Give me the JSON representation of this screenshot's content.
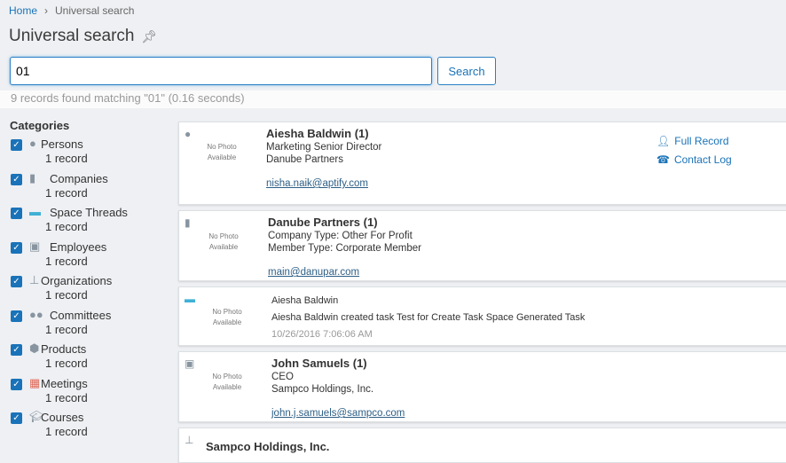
{
  "breadcrumb": {
    "home": "Home",
    "current": "Universal search"
  },
  "page_title": "Universal search",
  "search": {
    "value": "01",
    "button": "Search"
  },
  "status": "9 records found matching \"01\" (0.16 seconds)",
  "categories": {
    "title": "Categories",
    "items": [
      {
        "label": "Persons",
        "count": "1 record",
        "icon": "person-icon"
      },
      {
        "label": "Companies",
        "count": "1 record",
        "icon": "building-icon"
      },
      {
        "label": "Space Threads",
        "count": "1 record",
        "icon": "chat-icon"
      },
      {
        "label": "Employees",
        "count": "1 record",
        "icon": "monitor-icon"
      },
      {
        "label": "Organizations",
        "count": "1 record",
        "icon": "sitemap-icon"
      },
      {
        "label": "Committees",
        "count": "1 record",
        "icon": "group-icon"
      },
      {
        "label": "Products",
        "count": "1 record",
        "icon": "box-icon"
      },
      {
        "label": "Meetings",
        "count": "1 record",
        "icon": "calendar-icon"
      },
      {
        "label": "Courses",
        "count": "1 record",
        "icon": "graduation-cap-icon"
      }
    ]
  },
  "no_photo": "No Photo Available",
  "results": [
    {
      "title": "Aiesha Baldwin (1)",
      "lines": [
        "Marketing Senior Director",
        "Danube Partners"
      ],
      "email": "nisha.naik@aptify.com",
      "actions": [
        "Full Record",
        "Contact Log"
      ]
    },
    {
      "title": "Danube Partners (1)",
      "lines": [
        "Company Type: Other For Profit",
        "Member Type: Corporate Member"
      ],
      "email": "main@danupar.com"
    },
    {
      "title": "Aiesha Baldwin",
      "lines": [
        "Aiesha Baldwin created task Test for Create Task Space Generated Task"
      ],
      "timestamp": "10/26/2016 7:06:06 AM"
    },
    {
      "title": "John Samuels (1)",
      "lines": [
        "CEO",
        "Sampco Holdings, Inc."
      ],
      "email": "john.j.samuels@sampco.com"
    },
    {
      "title": "Sampco Holdings, Inc."
    }
  ]
}
